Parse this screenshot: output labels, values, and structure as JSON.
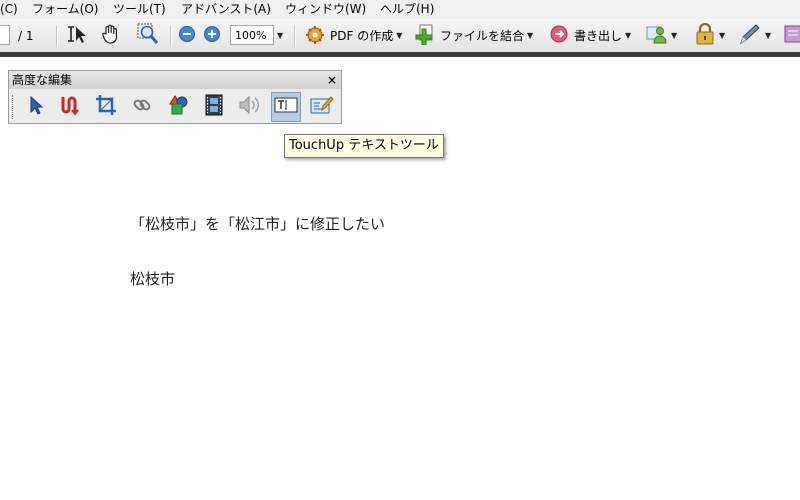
{
  "menu": {
    "items": [
      "(C)",
      "フォーム(O)",
      "ツール(T)",
      "アドバンスト(A)",
      "ウィンドウ(W)",
      "ヘルプ(H)"
    ]
  },
  "toolbar": {
    "page_total": "/ 1",
    "zoom_value": "100%",
    "create_pdf_label": "PDF の作成",
    "combine_files_label": "ファイルを結合",
    "export_label": "書き出し"
  },
  "panel": {
    "title": "高度な編集",
    "close": "×",
    "active_tool": "touchup-text"
  },
  "tooltip": {
    "text": "TouchUp テキストツール"
  },
  "document": {
    "line1": "「松枝市」を「松江市」に修正したい",
    "line2": "松枝市"
  },
  "colors": {
    "accent": "#2a63b8",
    "toolbar_dark": "#3d3d3d",
    "tooltip_bg": "#ffffe1"
  }
}
